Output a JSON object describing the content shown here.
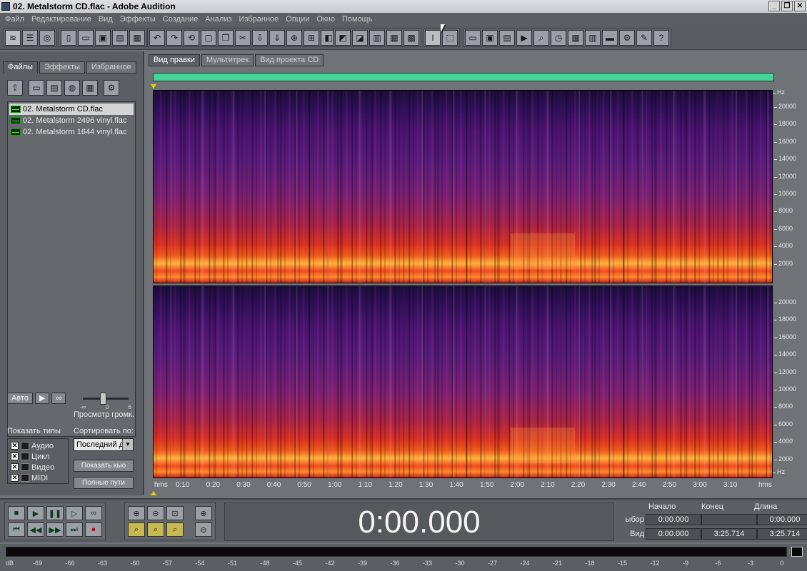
{
  "window": {
    "title": "02. Metalstorm CD.flac - Adobe Audition",
    "controls": [
      "_",
      "❐",
      "✕"
    ]
  },
  "menu": [
    "Файл",
    "Редактирование",
    "Вид",
    "Эффекты",
    "Создание",
    "Анализ",
    "Избранное",
    "Опции",
    "Окно",
    "Помощь"
  ],
  "left_panel": {
    "tabs": [
      {
        "label": "Файлы",
        "active": true
      },
      {
        "label": "Эффекты",
        "active": false
      },
      {
        "label": "Избранное",
        "active": false
      }
    ],
    "files": [
      {
        "name": "02. Metalstorm CD.flac",
        "selected": true
      },
      {
        "name": "02. Metalstorm 2496 vinyl.flac",
        "selected": false
      },
      {
        "name": "02. Metalstorm 1644 vinyl.flac",
        "selected": false
      }
    ],
    "auto_label": "Авто",
    "preview_volume_label": "Просмотр громк.",
    "slider_labels": [
      "-∞",
      "0",
      "6"
    ],
    "show_types_label": "Показать типы",
    "types": [
      {
        "label": "Аудио",
        "checked": true
      },
      {
        "label": "Цикл",
        "checked": true
      },
      {
        "label": "Видео",
        "checked": true
      },
      {
        "label": "MIDI",
        "checked": true
      }
    ],
    "sort_label": "Сортировать по:",
    "sort_value": "Последний д",
    "show_cue_label": "Показать кью",
    "full_paths_label": "Полные пути"
  },
  "view_tabs": [
    {
      "label": "Вид правки",
      "active": true
    },
    {
      "label": "Мультитрек",
      "active": false
    },
    {
      "label": "Вид проекта CD",
      "active": false
    }
  ],
  "freq_scale": {
    "unit": "Hz",
    "labels": [
      "20000",
      "18000",
      "16000",
      "14000",
      "12000",
      "10000",
      "8000",
      "6000",
      "4000",
      "2000"
    ]
  },
  "time_scale": {
    "unit": "hms",
    "labels": [
      "0:10",
      "0:20",
      "0:30",
      "0:40",
      "0:50",
      "1:00",
      "1:10",
      "1:20",
      "1:30",
      "1:40",
      "1:50",
      "2:00",
      "2:10",
      "2:20",
      "2:30",
      "2:40",
      "2:50",
      "3:00",
      "3:10"
    ]
  },
  "transport": {
    "time": "0:00.000"
  },
  "selection": {
    "headers": [
      "Начало",
      "Конец",
      "Длина"
    ],
    "rows": [
      {
        "label": "ыбор",
        "start": "0:00.000",
        "end": "",
        "length": "0:00.000"
      },
      {
        "label": "Вид",
        "start": "0:00.000",
        "end": "3:25.714",
        "length": "3:25.714"
      }
    ]
  },
  "level_meter": {
    "labels": [
      "dB",
      "-69",
      "-66",
      "-63",
      "-60",
      "-57",
      "-54",
      "-51",
      "-48",
      "-45",
      "-42",
      "-39",
      "-36",
      "-33",
      "-30",
      "-27",
      "-24",
      "-21",
      "-18",
      "-15",
      "-12",
      "-9",
      "-6",
      "-3",
      "0"
    ]
  },
  "colors": {
    "panel": "#5b5f64",
    "overview": "#46d49a",
    "marker": "#f0d000"
  }
}
